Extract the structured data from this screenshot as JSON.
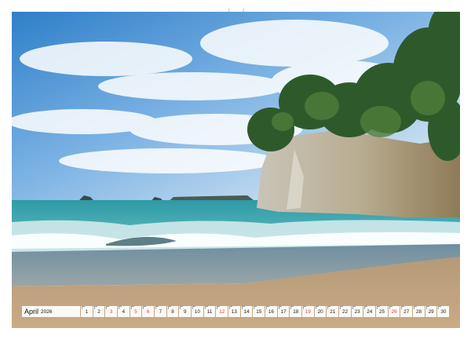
{
  "calendar": {
    "month": "April",
    "year": "2026",
    "days": [
      {
        "n": "1",
        "red": false
      },
      {
        "n": "2",
        "red": false
      },
      {
        "n": "3",
        "red": true
      },
      {
        "n": "4",
        "red": false
      },
      {
        "n": "5",
        "red": true
      },
      {
        "n": "6",
        "red": true
      },
      {
        "n": "7",
        "red": false
      },
      {
        "n": "8",
        "red": false
      },
      {
        "n": "9",
        "red": false
      },
      {
        "n": "10",
        "red": false
      },
      {
        "n": "11",
        "red": false
      },
      {
        "n": "12",
        "red": true
      },
      {
        "n": "13",
        "red": false
      },
      {
        "n": "14",
        "red": false
      },
      {
        "n": "15",
        "red": false
      },
      {
        "n": "16",
        "red": false
      },
      {
        "n": "17",
        "red": false
      },
      {
        "n": "18",
        "red": false
      },
      {
        "n": "19",
        "red": true
      },
      {
        "n": "20",
        "red": false
      },
      {
        "n": "21",
        "red": false
      },
      {
        "n": "22",
        "red": false
      },
      {
        "n": "23",
        "red": false
      },
      {
        "n": "24",
        "red": false
      },
      {
        "n": "25",
        "red": false
      },
      {
        "n": "26",
        "red": true
      },
      {
        "n": "27",
        "red": false
      },
      {
        "n": "28",
        "red": false
      },
      {
        "n": "29",
        "red": false
      },
      {
        "n": "30",
        "red": false
      }
    ],
    "colors": {
      "weekday": "#222222",
      "sunday_holiday": "#d9473a"
    }
  },
  "photo": {
    "subject": "beach-cliff-seascape-photo"
  }
}
